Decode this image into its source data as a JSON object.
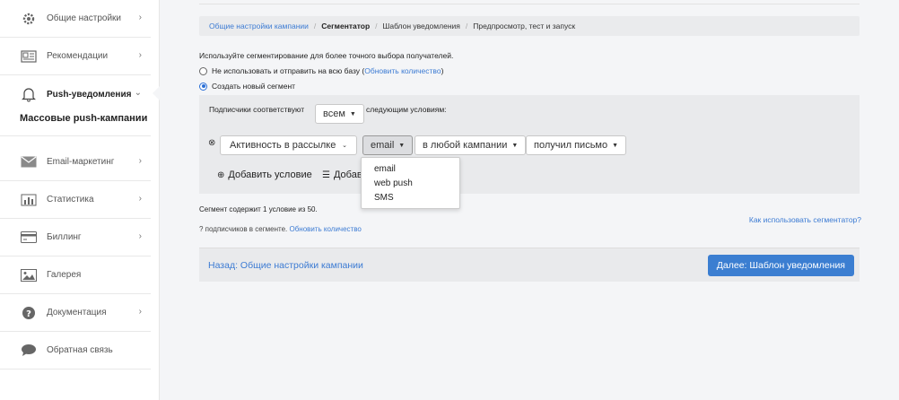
{
  "sidebar": {
    "items": [
      {
        "label": "Общие настройки",
        "icon": "gear-icon"
      },
      {
        "label": "Рекомендации",
        "icon": "newspaper-icon"
      },
      {
        "label": "Push-уведомления",
        "icon": "bell-icon"
      },
      {
        "label": "Email-маркетинг",
        "icon": "envelope-icon"
      },
      {
        "label": "Статистика",
        "icon": "bar-chart-icon"
      },
      {
        "label": "Биллинг",
        "icon": "credit-card-icon"
      },
      {
        "label": "Галерея",
        "icon": "image-icon"
      },
      {
        "label": "Документация",
        "icon": "question-icon"
      },
      {
        "label": "Обратная связь",
        "icon": "comment-icon"
      }
    ],
    "submenu_item": "Массовые push-кампании"
  },
  "breadcrumb": {
    "step1": "Общие настройки кампании",
    "step2": "Сегментатор",
    "step3": "Шаблон уведомления",
    "step4": "Предпросмотр, тест и запуск",
    "separator": "/"
  },
  "intro_text": "Используйте сегментирование для более точного выбора получателей.",
  "radio_all": {
    "label_prefix": "Не использовать и отправить на всю базу (",
    "link": "Обновить количество",
    "label_suffix": ")"
  },
  "radio_new": {
    "label": "Создать новый сегмент"
  },
  "segment": {
    "match_prefix": "Подписчики соответствуют",
    "match_value": "всем",
    "match_suffix": "следующим условиям:",
    "condition": {
      "field": "Активность в рассылке",
      "channel": "email",
      "campaign": "в любой кампании",
      "action": "получил письмо"
    },
    "add_condition": "Добавить условие",
    "add_group_partial": "Добав"
  },
  "dropdown_options": [
    "email",
    "web push",
    "SMS"
  ],
  "status": {
    "conditions": "Сегмент содержит 1 условие из 50.",
    "subs_prefix": "? подписчиков в сегменте. ",
    "subs_link": "Обновить количество",
    "howto": "Как использовать сегментатор?"
  },
  "footer": {
    "back": "Назад: Общие настройки кампании",
    "next": "Далее: Шаблон уведомления"
  },
  "colors": {
    "accent": "#3b7ed1",
    "link": "#3c7bd3"
  }
}
